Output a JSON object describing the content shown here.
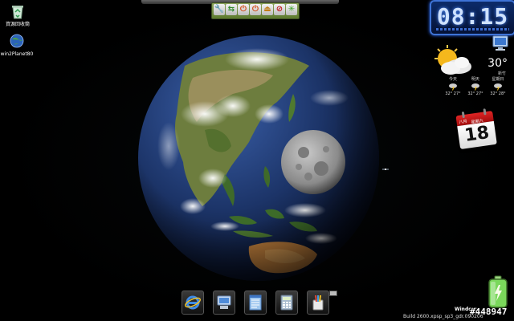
{
  "desktop": {
    "icons": [
      {
        "label": "資源回收筒",
        "icon": "recycle-bin-icon"
      },
      {
        "label": "win2Planet80",
        "icon": "planet-app-icon"
      }
    ]
  },
  "toolbar": {
    "buttons": [
      {
        "icon": "wrench-icon",
        "glyph": "🔧"
      },
      {
        "icon": "swap-icon",
        "glyph": "⇆"
      },
      {
        "icon": "power-icon",
        "glyph": "⏻"
      },
      {
        "icon": "power-icon",
        "glyph": "⏻"
      },
      {
        "icon": "eject-icon",
        "glyph": "⏏"
      },
      {
        "icon": "stop-icon",
        "glyph": "⊘"
      },
      {
        "icon": "sun-settings-icon",
        "glyph": "✳"
      }
    ]
  },
  "clock": {
    "time": "08:15"
  },
  "weather": {
    "temperature": "30°",
    "location": "新竹",
    "forecast": [
      {
        "day": "今天",
        "range": "32° 27°"
      },
      {
        "day": "明天",
        "range": "32° 27°"
      },
      {
        "day": "星期日",
        "range": "32° 28°"
      }
    ]
  },
  "calendar": {
    "month": "八月",
    "weekday": "星期六",
    "day": "18"
  },
  "dock": {
    "items": [
      {
        "icon": "internet-explorer-icon"
      },
      {
        "icon": "my-computer-icon"
      },
      {
        "icon": "notepad-icon"
      },
      {
        "icon": "calculator-icon"
      },
      {
        "icon": "paint-icon"
      }
    ]
  },
  "status": {
    "windows_label": "Windows",
    "build": "Build 2600.xpsp_sp3_gdr.090206",
    "watermark": "#448947"
  },
  "colors": {
    "clock_text": "#cfe2ff",
    "clock_border": "#3e73d6",
    "battery": "#5cd63c",
    "calendar_header": "#d31d1d"
  }
}
